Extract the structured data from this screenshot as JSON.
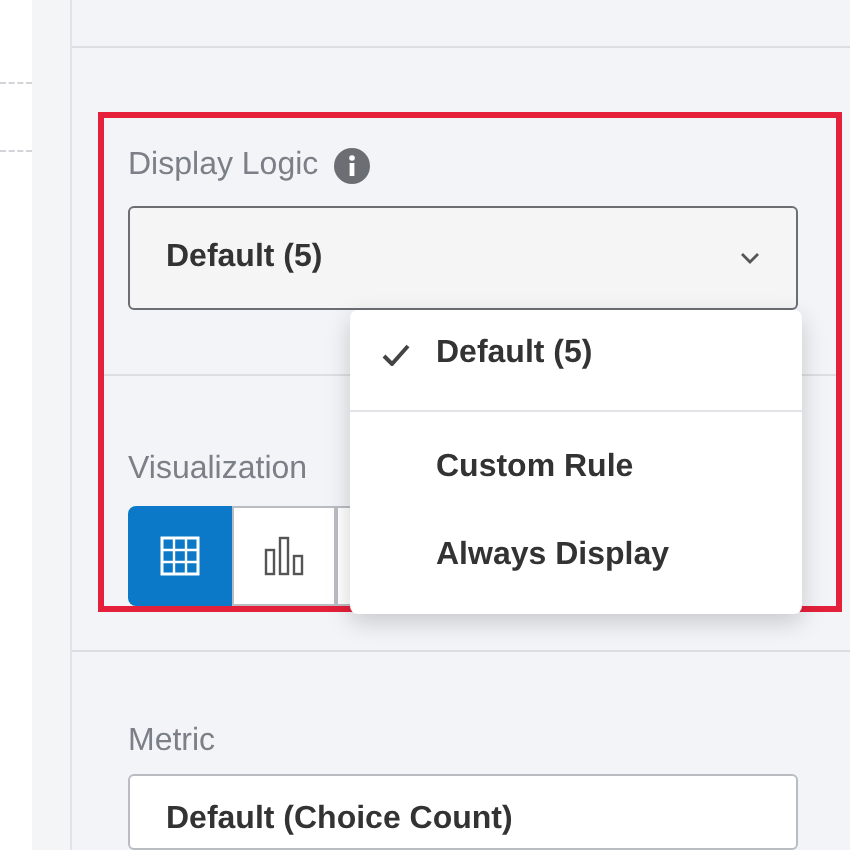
{
  "display_logic": {
    "label": "Display Logic",
    "value": "Default (5)",
    "menu": [
      {
        "label": "Default (5)",
        "selected": true
      },
      {
        "label": "Custom Rule",
        "selected": false
      },
      {
        "label": "Always Display",
        "selected": false
      }
    ]
  },
  "visualization": {
    "label": "Visualization",
    "options": [
      {
        "kind": "table",
        "selected": true
      },
      {
        "kind": "bar",
        "selected": false
      },
      {
        "kind": "other",
        "selected": false
      }
    ]
  },
  "metric": {
    "label": "Metric",
    "value": "Default (Choice Count)"
  }
}
